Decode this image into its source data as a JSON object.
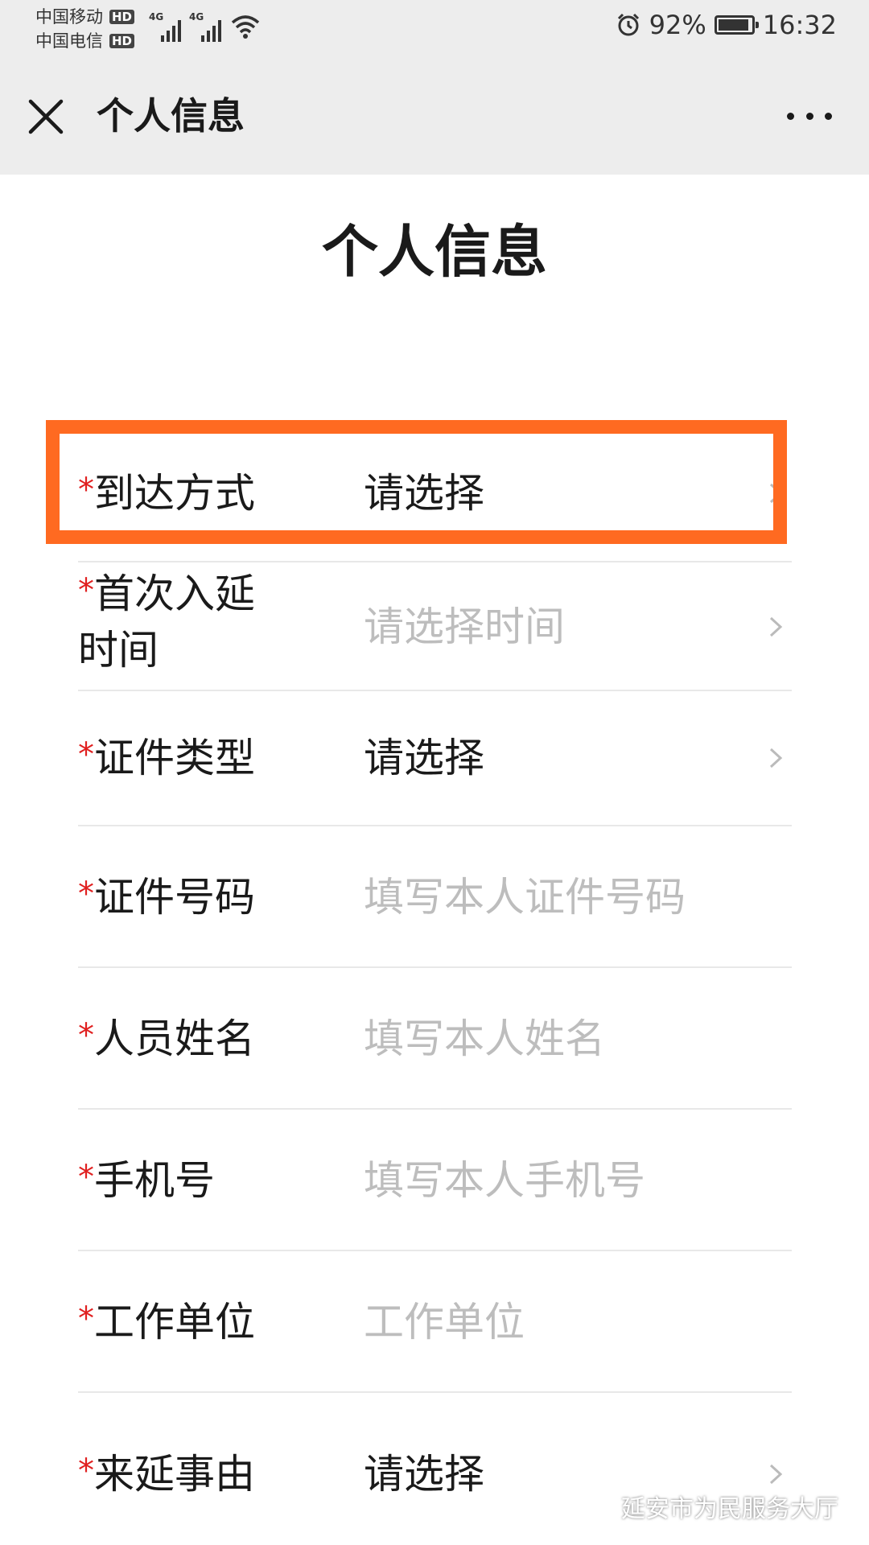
{
  "status_bar": {
    "carrier1": "中国移动",
    "carrier2": "中国电信",
    "hd_badge": "HD",
    "net_label": "4G",
    "battery_percent": "92%",
    "battery_level": 0.92,
    "time": "16:32"
  },
  "nav": {
    "title": "个人信息"
  },
  "page": {
    "title": "个人信息"
  },
  "form": {
    "required_mark": "*",
    "rows": [
      {
        "label": "到达方式",
        "value": "请选择",
        "placeholder": false,
        "chevron": true
      },
      {
        "label": "首次入延时间",
        "label_line1": "首次入延",
        "label_line2": "时间",
        "value": "请选择时间",
        "placeholder": true,
        "chevron": true
      },
      {
        "label": "证件类型",
        "value": "请选择",
        "placeholder": false,
        "chevron": true
      },
      {
        "label": "证件号码",
        "value": "填写本人证件号码",
        "placeholder": true,
        "chevron": false
      },
      {
        "label": "人员姓名",
        "value": "填写本人姓名",
        "placeholder": true,
        "chevron": false
      },
      {
        "label": "手机号",
        "value": "填写本人手机号",
        "placeholder": true,
        "chevron": false
      },
      {
        "label": "工作单位",
        "value": "工作单位",
        "placeholder": true,
        "chevron": false
      },
      {
        "label": "来延事由",
        "value": "请选择",
        "placeholder": false,
        "chevron": true
      }
    ]
  },
  "colors": {
    "highlight": "#ff6a21",
    "required": "#e02020",
    "placeholder": "#bdbdbd"
  },
  "watermark": {
    "text": "延安市为民服务大厅"
  }
}
